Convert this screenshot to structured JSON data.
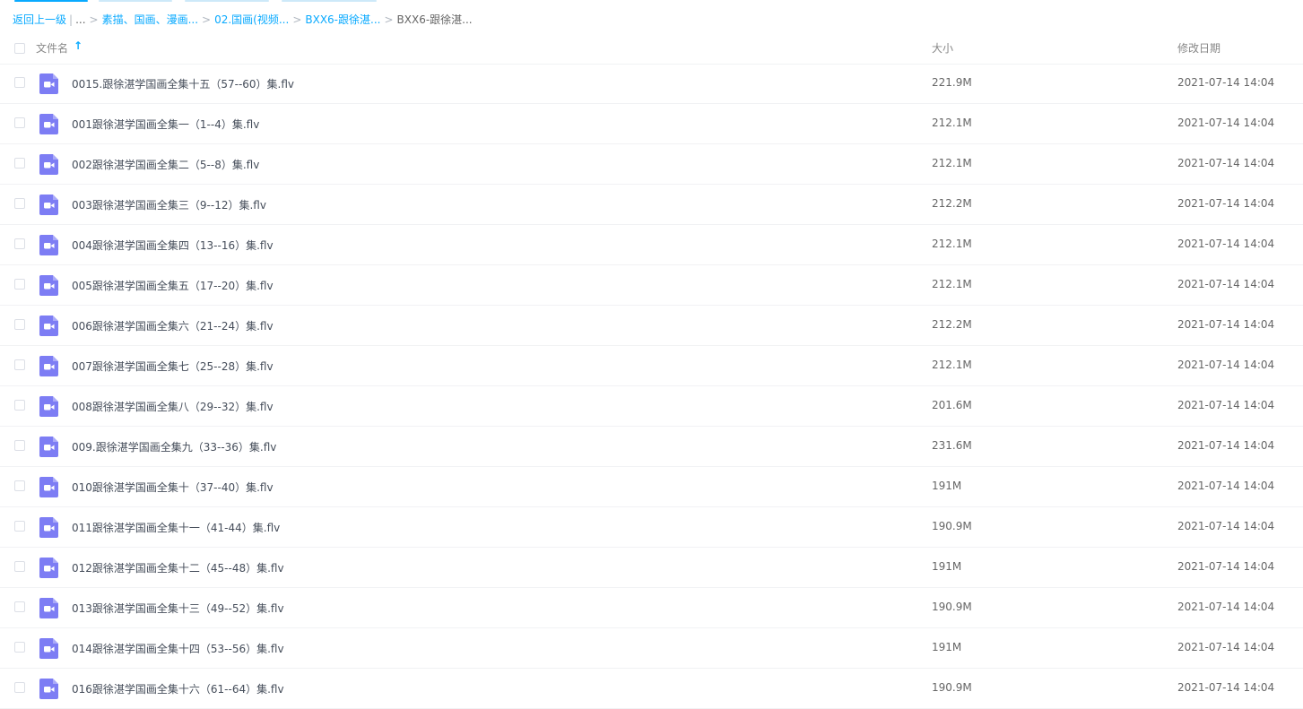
{
  "colors": {
    "accent": "#09AAFF",
    "video_icon": "#7D7DF4",
    "tab_colors": [
      "#09AAFF",
      "#cde9f9",
      "#cde9f9",
      "#cde9f9"
    ]
  },
  "breadcrumb": {
    "back": "返回上一级",
    "pipe": "|",
    "ellipsis": "...",
    "items": [
      "素描、国画、漫画...",
      "02.国画(视频...",
      "BXX6-跟徐湛..."
    ],
    "current": "BXX6-跟徐湛...",
    "separator": ">"
  },
  "header": {
    "name": "文件名",
    "sort_icon": "arrow-up",
    "size": "大小",
    "date": "修改日期"
  },
  "files": [
    {
      "name": "0015.跟徐湛学国画全集十五（57--60）集.flv",
      "size": "221.9M",
      "date": "2021-07-14 14:04",
      "icon": "video-file-icon"
    },
    {
      "name": "001跟徐湛学国画全集一（1--4）集.flv",
      "size": "212.1M",
      "date": "2021-07-14 14:04",
      "icon": "video-file-icon"
    },
    {
      "name": "002跟徐湛学国画全集二（5--8）集.flv",
      "size": "212.1M",
      "date": "2021-07-14 14:04",
      "icon": "video-file-icon"
    },
    {
      "name": "003跟徐湛学国画全集三（9--12）集.flv",
      "size": "212.2M",
      "date": "2021-07-14 14:04",
      "icon": "video-file-icon"
    },
    {
      "name": "004跟徐湛学国画全集四（13--16）集.flv",
      "size": "212.1M",
      "date": "2021-07-14 14:04",
      "icon": "video-file-icon"
    },
    {
      "name": "005跟徐湛学国画全集五（17--20）集.flv",
      "size": "212.1M",
      "date": "2021-07-14 14:04",
      "icon": "video-file-icon"
    },
    {
      "name": "006跟徐湛学国画全集六（21--24）集.flv",
      "size": "212.2M",
      "date": "2021-07-14 14:04",
      "icon": "video-file-icon"
    },
    {
      "name": "007跟徐湛学国画全集七（25--28）集.flv",
      "size": "212.1M",
      "date": "2021-07-14 14:04",
      "icon": "video-file-icon"
    },
    {
      "name": "008跟徐湛学国画全集八（29--32）集.flv",
      "size": "201.6M",
      "date": "2021-07-14 14:04",
      "icon": "video-file-icon"
    },
    {
      "name": "009.跟徐湛学国画全集九（33--36）集.flv",
      "size": "231.6M",
      "date": "2021-07-14 14:04",
      "icon": "video-file-icon"
    },
    {
      "name": "010跟徐湛学国画全集十（37--40）集.flv",
      "size": "191M",
      "date": "2021-07-14 14:04",
      "icon": "video-file-icon"
    },
    {
      "name": "011跟徐湛学国画全集十一（41-44）集.flv",
      "size": "190.9M",
      "date": "2021-07-14 14:04",
      "icon": "video-file-icon"
    },
    {
      "name": "012跟徐湛学国画全集十二（45--48）集.flv",
      "size": "191M",
      "date": "2021-07-14 14:04",
      "icon": "video-file-icon"
    },
    {
      "name": "013跟徐湛学国画全集十三（49--52）集.flv",
      "size": "190.9M",
      "date": "2021-07-14 14:04",
      "icon": "video-file-icon"
    },
    {
      "name": "014跟徐湛学国画全集十四（53--56）集.flv",
      "size": "191M",
      "date": "2021-07-14 14:04",
      "icon": "video-file-icon"
    },
    {
      "name": "016跟徐湛学国画全集十六（61--64）集.flv",
      "size": "190.9M",
      "date": "2021-07-14 14:04",
      "icon": "video-file-icon"
    }
  ]
}
